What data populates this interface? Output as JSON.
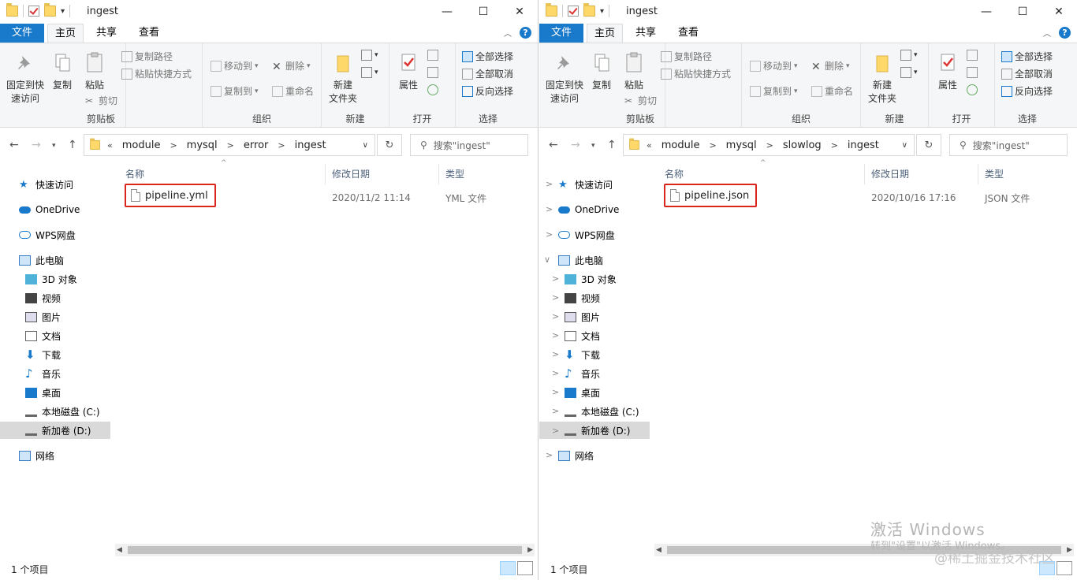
{
  "windows": [
    {
      "title": "ingest",
      "tabs": {
        "file": "文件",
        "home": "主页",
        "share": "共享",
        "view": "查看"
      },
      "ribbon": {
        "pin": "固定到快\n速访问",
        "copy": "复制",
        "paste": "粘贴",
        "copy_path": "复制路径",
        "paste_shortcut": "粘贴快捷方式",
        "cut": "剪切",
        "move_to": "移动到",
        "copy_to": "复制到",
        "delete": "删除",
        "rename": "重命名",
        "new_folder": "新建\n文件夹",
        "properties": "属性",
        "select_all": "全部选择",
        "select_none": "全部取消",
        "invert": "反向选择",
        "groups": {
          "clipboard": "剪贴板",
          "organize": "组织",
          "new": "新建",
          "open": "打开",
          "select": "选择"
        }
      },
      "address": [
        "module",
        "mysql",
        "error",
        "ingest"
      ],
      "search_placeholder": "搜索\"ingest\"",
      "columns": {
        "name": "名称",
        "date": "修改日期",
        "type": "类型"
      },
      "files": [
        {
          "name": "pipeline.yml",
          "date": "2020/11/2 11:14",
          "type": "YML 文件"
        }
      ],
      "status": "1 个项目"
    },
    {
      "title": "ingest",
      "tabs": {
        "file": "文件",
        "home": "主页",
        "share": "共享",
        "view": "查看"
      },
      "ribbon": {
        "pin": "固定到快\n速访问",
        "copy": "复制",
        "paste": "粘贴",
        "copy_path": "复制路径",
        "paste_shortcut": "粘贴快捷方式",
        "cut": "剪切",
        "move_to": "移动到",
        "copy_to": "复制到",
        "delete": "删除",
        "rename": "重命名",
        "new_folder": "新建\n文件夹",
        "properties": "属性",
        "select_all": "全部选择",
        "select_none": "全部取消",
        "invert": "反向选择",
        "groups": {
          "clipboard": "剪贴板",
          "organize": "组织",
          "new": "新建",
          "open": "打开",
          "select": "选择"
        }
      },
      "address": [
        "module",
        "mysql",
        "slowlog",
        "ingest"
      ],
      "search_placeholder": "搜索\"ingest\"",
      "columns": {
        "name": "名称",
        "date": "修改日期",
        "type": "类型"
      },
      "files": [
        {
          "name": "pipeline.json",
          "date": "2020/10/16 17:16",
          "type": "JSON 文件"
        }
      ],
      "status": "1 个项目"
    }
  ],
  "nav": {
    "quick_access": "快速访问",
    "onedrive": "OneDrive",
    "wps": "WPS网盘",
    "this_pc": "此电脑",
    "objects3d": "3D 对象",
    "videos": "视频",
    "pictures": "图片",
    "documents": "文档",
    "downloads": "下载",
    "music": "音乐",
    "desktop": "桌面",
    "local_c": "本地磁盘 (C:)",
    "new_d": "新加卷 (D:)",
    "network": "网络"
  },
  "overlay": {
    "activate_title": "激活 Windows",
    "activate_sub": "转到\"设置\"以激活 Windows。",
    "watermark": "@稀土掘金技术社区"
  },
  "colors": {
    "accent": "#1979ca",
    "highlight_border": "#d9251c",
    "selected_nav": "#d9d9d9"
  }
}
